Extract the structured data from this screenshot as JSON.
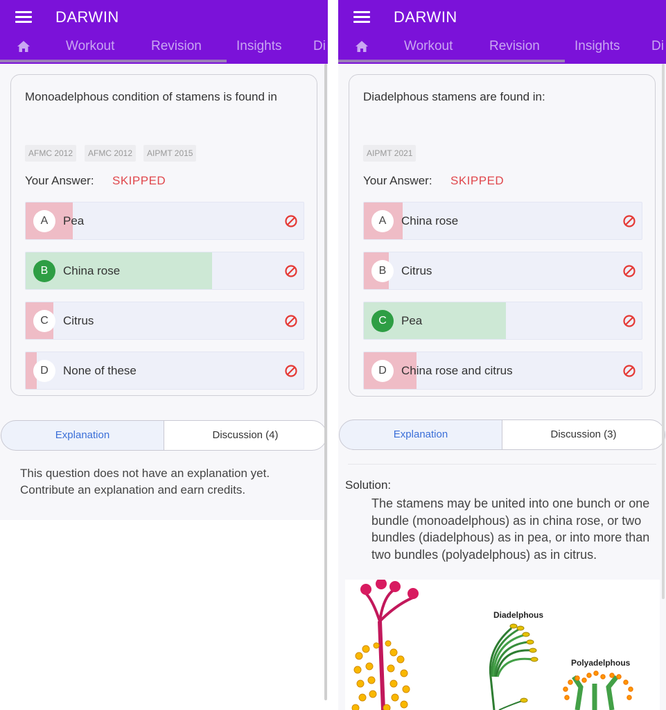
{
  "left": {
    "app_title": "DARWIN",
    "tabs": [
      "Workout",
      "Revision",
      "Insights",
      "Di"
    ],
    "question": "Monoadelphous condition of stamens is found in",
    "tags": [
      "AFMC 2012",
      "AFMC 2012",
      "AIPMT 2015"
    ],
    "your_answer_label": "Your Answer:",
    "your_answer_value": "SKIPPED",
    "options": [
      {
        "letter": "A",
        "text": "Pea",
        "correct": false,
        "fill_fraction": 0.17
      },
      {
        "letter": "B",
        "text": "China rose",
        "correct": true,
        "fill_fraction": 0.67
      },
      {
        "letter": "C",
        "text": "Citrus",
        "correct": false,
        "fill_fraction": 0.1
      },
      {
        "letter": "D",
        "text": "None of these",
        "correct": false,
        "fill_fraction": 0.04
      }
    ],
    "explanation_tab": "Explanation",
    "discussion_tab": "Discussion (4)",
    "explanation_text": "This question does not have an explanation yet. Contribute an explanation and earn credits."
  },
  "right": {
    "app_title": "DARWIN",
    "tabs": [
      "Workout",
      "Revision",
      "Insights",
      "Di"
    ],
    "question": "Diadelphous stamens are found in:",
    "tags": [
      "AIPMT 2021"
    ],
    "your_answer_label": "Your Answer:",
    "your_answer_value": "SKIPPED",
    "options": [
      {
        "letter": "A",
        "text": "China rose",
        "correct": false,
        "fill_fraction": 0.14
      },
      {
        "letter": "B",
        "text": "Citrus",
        "correct": false,
        "fill_fraction": 0.09
      },
      {
        "letter": "C",
        "text": "Pea",
        "correct": true,
        "fill_fraction": 0.51
      },
      {
        "letter": "D",
        "text": "China rose and citrus",
        "correct": false,
        "fill_fraction": 0.19
      }
    ],
    "explanation_tab": "Explanation",
    "discussion_tab": "Discussion (3)",
    "solution_label": "Solution:",
    "solution_text": "The stamens may be united into one bunch or one bundle (monoadelphous) as in china rose, or two bundles (diadelphous) as in pea, or into more than two bundles (polyadelphous) as in citrus.",
    "figure_labels": {
      "diadelphous": "Diadelphous",
      "polyadelphous": "Polyadelphous"
    }
  },
  "colors": {
    "appbar": "#7b12d9",
    "skipped": "#e0474c",
    "correct_fill": "#cde8d5",
    "correct_circle": "#2e9e44",
    "wrong_fill": "#efbcc6",
    "explanation_link": "#3b6fd8"
  },
  "icons": [
    "menu-icon",
    "home-icon",
    "ban-icon"
  ]
}
